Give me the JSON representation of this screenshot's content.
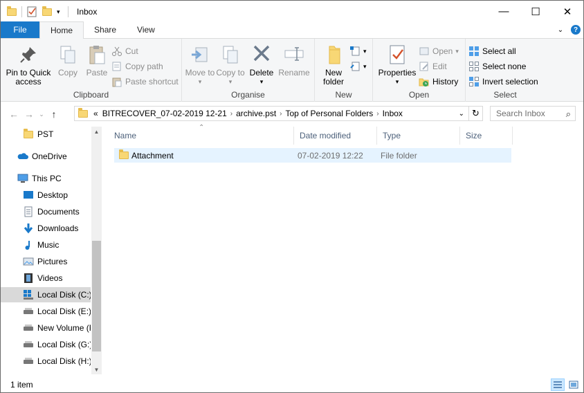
{
  "window": {
    "title": "Inbox",
    "controls": {
      "minimize": "—",
      "maximize": "☐",
      "close": "✕"
    }
  },
  "tabs": [
    {
      "label": "File"
    },
    {
      "label": "Home"
    },
    {
      "label": "Share"
    },
    {
      "label": "View"
    }
  ],
  "ribbon": {
    "clipboard": {
      "label": "Clipboard",
      "pin": "Pin to Quick access",
      "copy": "Copy",
      "paste": "Paste",
      "cut": "Cut",
      "copy_path": "Copy path",
      "paste_shortcut": "Paste shortcut"
    },
    "organise": {
      "label": "Organise",
      "move_to": "Move to",
      "copy_to": "Copy to",
      "delete": "Delete",
      "rename": "Rename"
    },
    "new": {
      "label": "New",
      "new_folder": "New folder"
    },
    "open": {
      "label": "Open",
      "properties": "Properties",
      "open": "Open",
      "edit": "Edit",
      "history": "History"
    },
    "select": {
      "label": "Select",
      "select_all": "Select all",
      "select_none": "Select none",
      "invert": "Invert selection"
    }
  },
  "address": {
    "prefix": "«",
    "crumbs": [
      "BITRECOVER_07-02-2019 12-21",
      "archive.pst",
      "Top of Personal Folders",
      "Inbox"
    ],
    "search_placeholder": "Search Inbox"
  },
  "nav": [
    {
      "label": "PST"
    },
    {
      "label": "OneDrive"
    },
    {
      "label": "This PC"
    },
    {
      "label": "Desktop"
    },
    {
      "label": "Documents"
    },
    {
      "label": "Downloads"
    },
    {
      "label": "Music"
    },
    {
      "label": "Pictures"
    },
    {
      "label": "Videos"
    },
    {
      "label": "Local Disk (C:)"
    },
    {
      "label": "Local Disk (E:)"
    },
    {
      "label": "New Volume (F:)"
    },
    {
      "label": "Local Disk (G:)"
    },
    {
      "label": "Local Disk (H:)"
    }
  ],
  "columns": {
    "name": "Name",
    "date": "Date modified",
    "type": "Type",
    "size": "Size"
  },
  "rows": [
    {
      "name": "Attachment",
      "date": "07-02-2019 12:22",
      "type": "File folder",
      "size": ""
    }
  ],
  "status": {
    "count": "1 item"
  },
  "colors": {
    "accent": "#1979ca",
    "selection": "#e5f3ff",
    "header_text": "#4c607a"
  }
}
